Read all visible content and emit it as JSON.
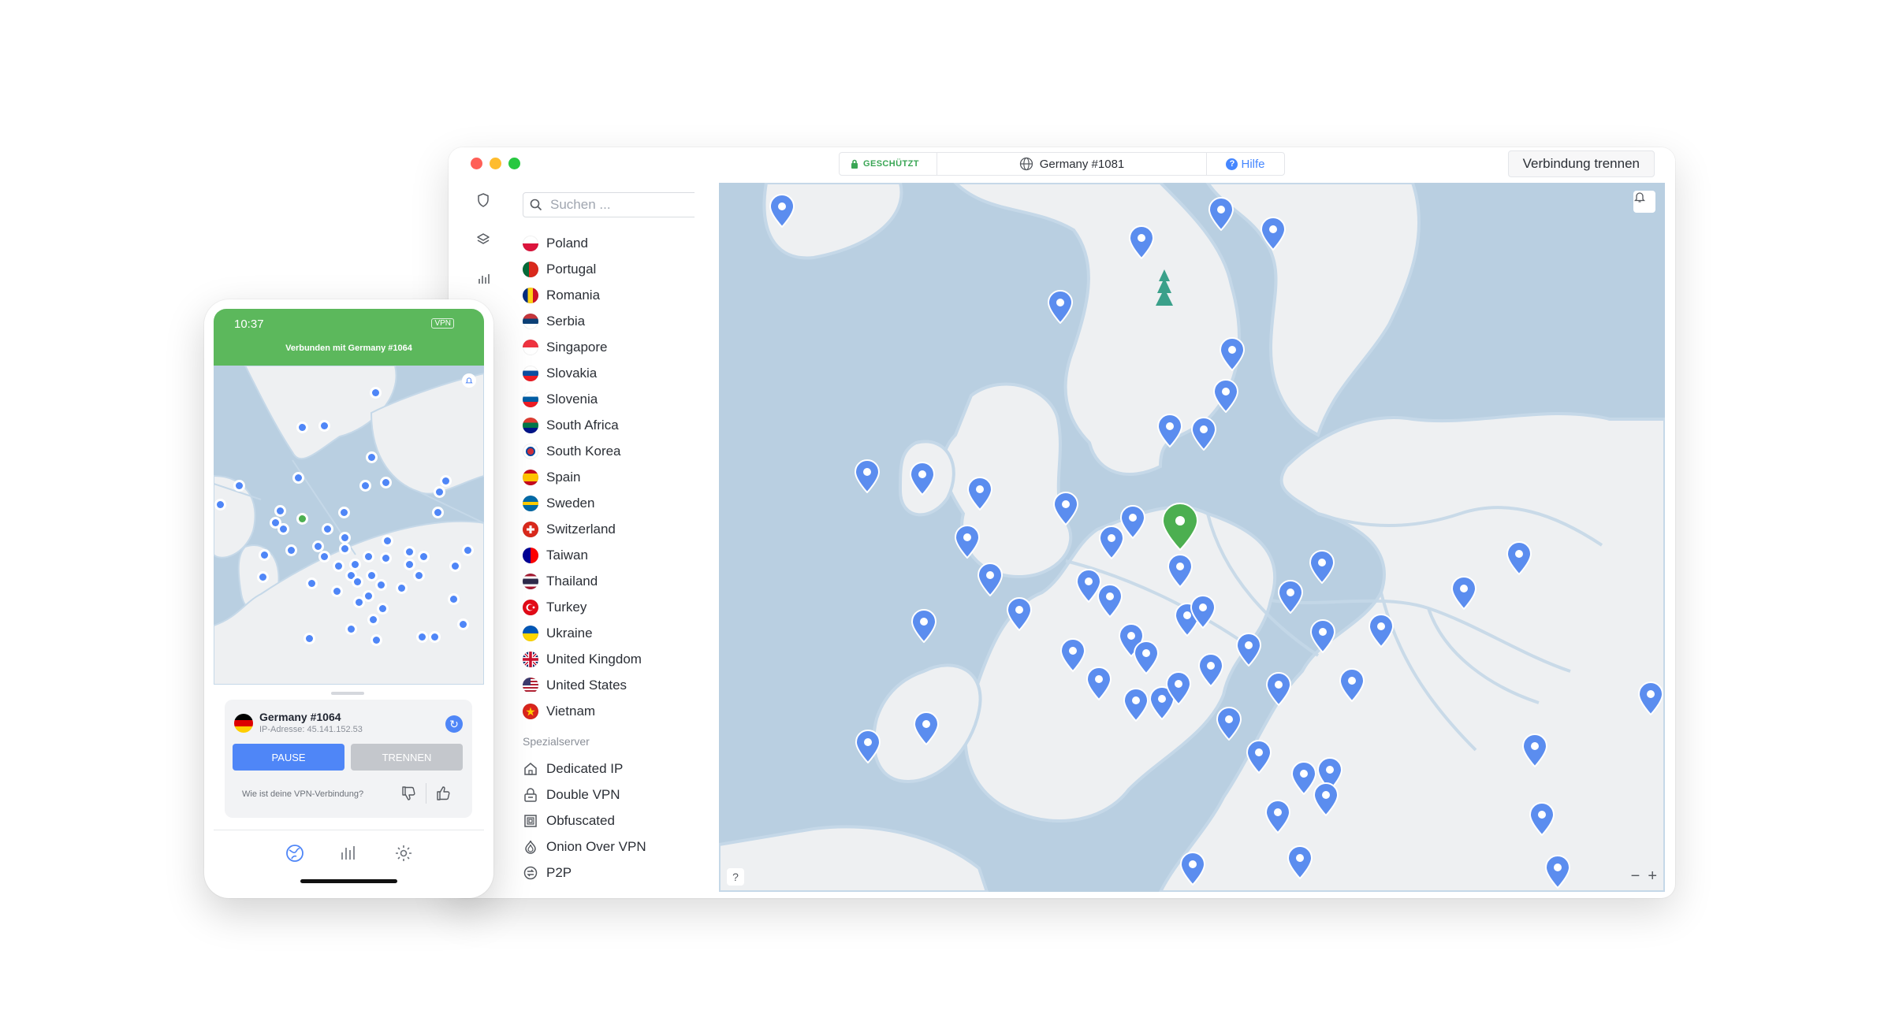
{
  "desktop": {
    "status": {
      "protected": "GESCHÜTZT",
      "server": "Germany #1081",
      "help": "Hilfe"
    },
    "disconnect_label": "Verbindung trennen",
    "search_placeholder": "Suchen ...",
    "countries": [
      {
        "name": "Poland",
        "flag": "poland-flag"
      },
      {
        "name": "Portugal",
        "flag": "portugal-flag"
      },
      {
        "name": "Romania",
        "flag": "romania-flag"
      },
      {
        "name": "Serbia",
        "flag": "serbia-flag"
      },
      {
        "name": "Singapore",
        "flag": "singapore-flag"
      },
      {
        "name": "Slovakia",
        "flag": "slovakia-flag"
      },
      {
        "name": "Slovenia",
        "flag": "slovenia-flag"
      },
      {
        "name": "South Africa",
        "flag": "south-africa-flag"
      },
      {
        "name": "South Korea",
        "flag": "south-korea-flag"
      },
      {
        "name": "Spain",
        "flag": "spain-flag"
      },
      {
        "name": "Sweden",
        "flag": "sweden-flag"
      },
      {
        "name": "Switzerland",
        "flag": "switzerland-flag"
      },
      {
        "name": "Taiwan",
        "flag": "taiwan-flag"
      },
      {
        "name": "Thailand",
        "flag": "thailand-flag"
      },
      {
        "name": "Turkey",
        "flag": "turkey-flag"
      },
      {
        "name": "Ukraine",
        "flag": "ukraine-flag"
      },
      {
        "name": "United Kingdom",
        "flag": "uk-flag"
      },
      {
        "name": "United States",
        "flag": "us-flag"
      },
      {
        "name": "Vietnam",
        "flag": "vietnam-flag"
      }
    ],
    "special_label": "Spezialserver",
    "special_servers": [
      {
        "name": "Dedicated IP",
        "icon": "home-icon"
      },
      {
        "name": "Double VPN",
        "icon": "double-lock-icon"
      },
      {
        "name": "Obfuscated",
        "icon": "obfuscated-icon"
      },
      {
        "name": "Onion Over VPN",
        "icon": "onion-icon"
      },
      {
        "name": "P2P",
        "icon": "p2p-icon"
      }
    ],
    "map_help": "?",
    "zoom_out": "−",
    "zoom_in": "+",
    "colors": {
      "pin": "#5b8def",
      "connected_pin": "#4caf50",
      "land": "#eef0f2",
      "water": "#b9cfe1"
    }
  },
  "phone": {
    "time": "10:37",
    "vpn_badge": "VPN",
    "connected_text": "Verbunden mit Germany #1064",
    "server": "Germany #1064",
    "ip": "IP-Adresse: 45.141.152.53",
    "pause_label": "PAUSE",
    "disconnect_label": "TRENNEN",
    "rating_question": "Wie ist deine VPN-Verbindung?",
    "colors": {
      "header": "#5cb85c",
      "primary": "#4f86f7"
    }
  }
}
